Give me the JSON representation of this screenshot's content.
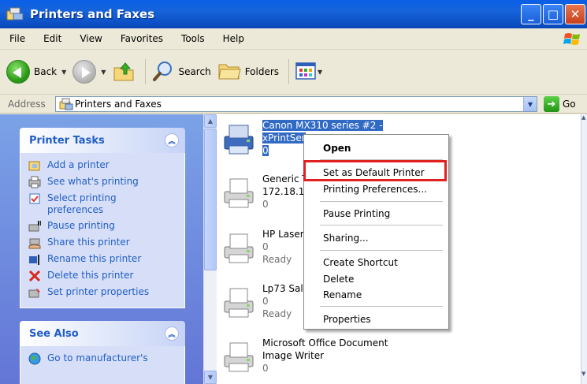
{
  "window": {
    "title": "Printers and Faxes"
  },
  "menu": [
    "File",
    "Edit",
    "View",
    "Favorites",
    "Tools",
    "Help"
  ],
  "toolbar": {
    "back_label": "Back",
    "search_label": "Search",
    "folders_label": "Folders"
  },
  "address": {
    "label": "Address",
    "value": "Printers and Faxes",
    "go_label": "Go"
  },
  "printer_tasks": {
    "title": "Printer Tasks",
    "items": [
      {
        "label": "Add a printer"
      },
      {
        "label": "See what's printing"
      },
      {
        "label": "Select printing preferences"
      },
      {
        "label": "Pause printing"
      },
      {
        "label": "Share this printer"
      },
      {
        "label": "Rename this printer"
      },
      {
        "label": "Delete this printer"
      },
      {
        "label": "Set printer properties"
      }
    ]
  },
  "see_also": {
    "title": "See Also",
    "items": [
      {
        "label": "Go to manufacturer's"
      }
    ]
  },
  "printers": [
    {
      "name_line1": "Canon MX310 series #2 -",
      "name_line2": "xPrintSer",
      "line3": "0",
      "status": ""
    },
    {
      "name_line1": "Generic T",
      "name_line2": "172.18.1",
      "line3": "0",
      "status": ""
    },
    {
      "name_line1": "HP Laser",
      "name_line2": "",
      "line3": "0",
      "status": "Ready"
    },
    {
      "name_line1": "Lp73 Sal",
      "name_line2": "",
      "line3": "0",
      "status": "Ready"
    },
    {
      "name_line1": "Microsoft Office Document",
      "name_line2": "Image Writer",
      "line3": "0",
      "status": ""
    }
  ],
  "context_menu": {
    "items": [
      {
        "label": "Open"
      },
      {
        "label": "Set as Default Printer"
      },
      {
        "label": "Printing Preferences..."
      },
      {
        "label": "Pause Printing"
      },
      {
        "label": "Sharing..."
      },
      {
        "label": "Create Shortcut"
      },
      {
        "label": "Delete"
      },
      {
        "label": "Rename"
      },
      {
        "label": "Properties"
      }
    ]
  },
  "colors": {
    "titlebar": "#0a5fe6",
    "selection": "#316ac5",
    "highlight_box": "#e0211f",
    "task_link": "#215dc6"
  }
}
